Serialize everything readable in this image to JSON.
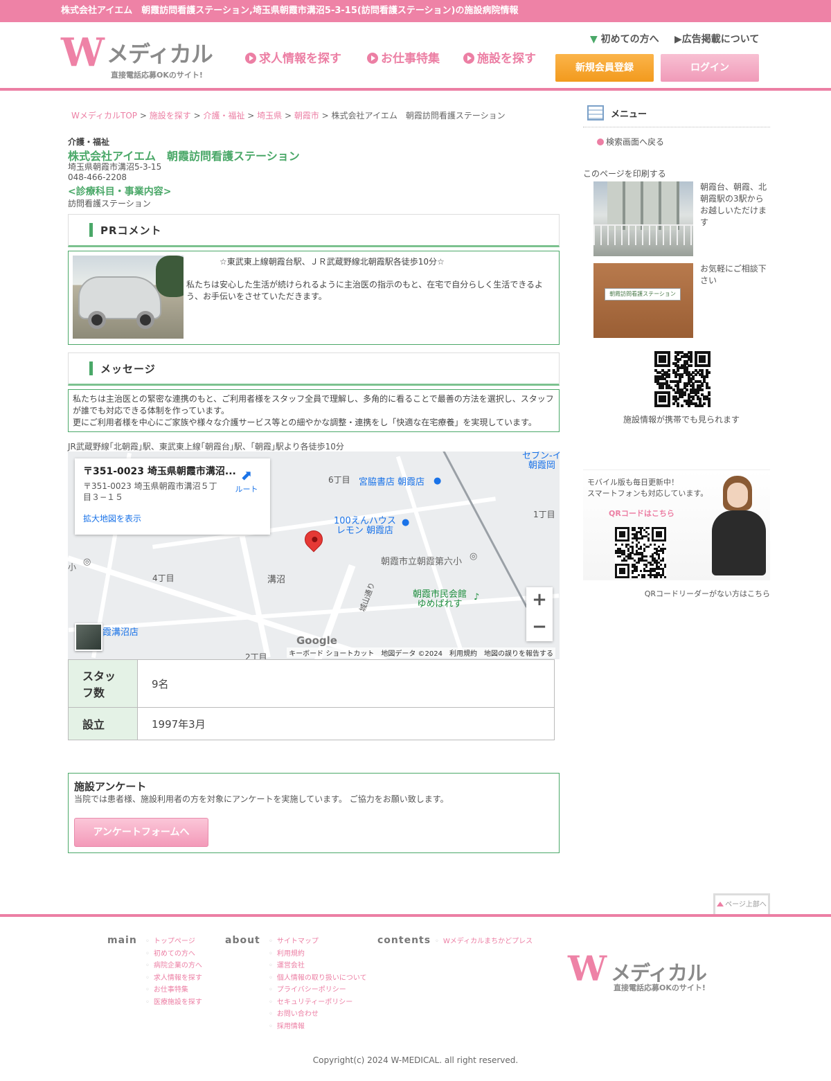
{
  "topbar": {
    "text": "株式会社アイエム　朝霞訪問看護ステーション,埼玉県朝霞市溝沼5-3-15(訪問看護ステーション)の施設病院情報"
  },
  "header": {
    "logo_mark": "W",
    "logo_brand": "メディカル",
    "logo_tag": "直接電話応募OKのサイト!",
    "nav": [
      "求人情報を探す",
      "お仕事特集",
      "施設を探す"
    ],
    "util_first": "初めての方へ",
    "util_ad": "広告掲載について",
    "register": "新規会員登録",
    "login": "ログイン"
  },
  "breadcrumb": {
    "items": [
      "WメディカルTOP",
      "施設を探す",
      "介護・福祉",
      "埼玉県",
      "朝霞市"
    ],
    "sep": " > ",
    "current": "株式会社アイエム　朝霞訪問看護ステーション"
  },
  "facility": {
    "category": "介護・福祉",
    "name": "株式会社アイエム　朝霞訪問看護ステーション",
    "address": "埼玉県朝霞市溝沼5-3-15",
    "tel": "048-466-2208",
    "dept_heading": "<診療科目・事業内容>",
    "dept_value": "訪問看護ステーション"
  },
  "pr": {
    "heading": "PRコメント",
    "line1": "☆東武東上線朝霞台駅、ＪＲ武蔵野線北朝霞駅各徒歩10分☆",
    "line2": "私たちは安心した生活が続けられるように主治医の指示のもと、在宅で自分らしく生活できるよう、お手伝いをさせていただきます。"
  },
  "message": {
    "heading": "メッセージ",
    "line1": "私たちは主治医との緊密な連携のもと、ご利用者様をスタッフ全員で理解し、多角的に看ることで最善の方法を選択し、スタッフが誰でも対応できる体制を作っています。",
    "line2": "更にご利用者様を中心にご家族や様々な介護サービス等との細やかな調整・連携をし「快適な在宅療養」を実現しています。"
  },
  "access": "JR武蔵野線｢北朝霞｣駅、東武東上線｢朝霞台｣駅、｢朝霞｣駅より各徒歩10分",
  "map": {
    "card_title": "〒351-0023 埼玉県朝霞市溝沼...",
    "card_address": "〒351-0023 埼玉県朝霞市溝沼５丁目３−１５",
    "card_link": "拡大地図を表示",
    "route": "ルート",
    "labels": {
      "l1": "6丁目",
      "l2": "1丁目",
      "l3": "4丁目",
      "l4": "溝沼",
      "l5": "2丁目",
      "l6": "城山通り",
      "l7": "小",
      "p1": "宮脇書店 朝霞店",
      "p2": "100えんハウス\nレモン 朝霞店",
      "p3": "朝霞市立朝霞第六小",
      "p4": "朝霞市民会館\nゆめぱれす",
      "p5": "セブン-イ\n朝霞岡",
      "p6": "霞溝沼店"
    },
    "google": "Google",
    "footer": "キーボード ショートカット　地図データ ©2024　利用規約　地図の誤りを報告する",
    "zoom_in": "+",
    "zoom_out": "−"
  },
  "info_table": [
    {
      "key": "スタッフ数",
      "value": "9名"
    },
    {
      "key": "設立",
      "value": "1997年3月"
    }
  ],
  "survey": {
    "heading": "施設アンケート",
    "desc": "当院では患者様、施設利用者の方を対象にアンケートを実施しています。 ご協力をお願い致します。",
    "button": "アンケートフォームへ"
  },
  "sidebar": {
    "menu_heading": "メニュー",
    "back": "検索画面へ戻る",
    "print": "このページを印刷する",
    "photo1_caption": "朝霞台、朝霞、北朝霞駅の3駅からお越しいただけます",
    "photo2_caption": "お気軽にご相談下さい",
    "photo2_plate": "朝霞訪問看護ステーション",
    "qr_caption": "施設情報が携帯でも見られます",
    "mobile_text": "モバイル版も毎日更新中！\nスマートフォンも対応しています。",
    "qr_label": "QRコードはこちら",
    "qr_reader": "QRコードリーダーがない方はこちら"
  },
  "pagetop": "ページ上部へ",
  "footer": {
    "main_heading": "main",
    "main_links": [
      "トップページ",
      "初めての方へ",
      "病院企業の方へ",
      "求人情報を探す",
      "お仕事特集",
      "医療施設を探す"
    ],
    "about_heading": "about",
    "about_links": [
      "サイトマップ",
      "利用規約",
      "運営会社",
      "個人情報の取り扱いについて",
      "プライバシーポリシー",
      "セキュリティーポリシー",
      "お問い合わせ",
      "採用情報"
    ],
    "contents_heading": "contents",
    "contents_links": [
      "Wメディカルまちかどプレス"
    ],
    "copyright": "Copyright(c) 2024 W-MEDICAL. all right reserved."
  },
  "colors": {
    "brand_pink": "#ec7fa4",
    "green": "#4aa868",
    "orange": "#f29a1d"
  }
}
